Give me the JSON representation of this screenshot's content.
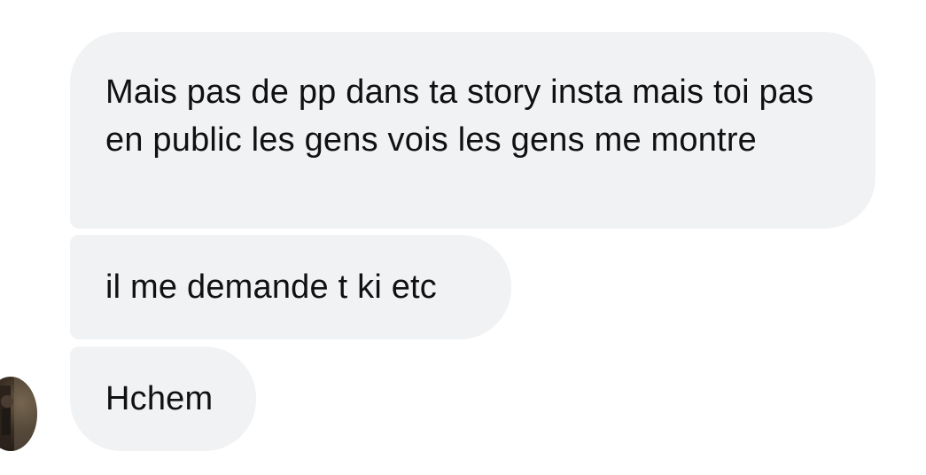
{
  "conversation": {
    "messages": [
      {
        "text": "Mais pas de pp dans ta story insta mais toi pas en public les gens vois les gens me montre"
      },
      {
        "text": "il me demande t ki etc"
      },
      {
        "text": "Hchem"
      }
    ]
  },
  "colors": {
    "bubble_background": "#f1f2f4",
    "text": "#111114",
    "page_background": "#ffffff"
  }
}
